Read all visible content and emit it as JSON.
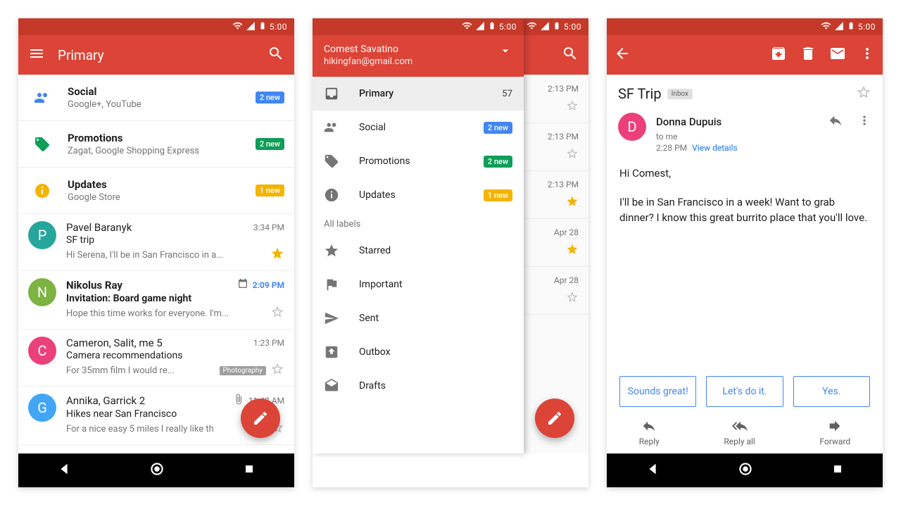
{
  "status": {
    "time": "5:00"
  },
  "screen1": {
    "title": "Primary",
    "categories": [
      {
        "icon": "people-icon",
        "title": "Social",
        "sub": "Google+, YouTube",
        "badge": "2 new",
        "badgeClass": "b-blue"
      },
      {
        "icon": "tag-icon",
        "title": "Promotions",
        "sub": "Zagat, Google Shopping Express",
        "badge": "2 new",
        "badgeClass": "b-green"
      },
      {
        "icon": "info-icon",
        "title": "Updates",
        "sub": "Google Store",
        "badge": "1 new",
        "badgeClass": "b-amber"
      }
    ],
    "messages": [
      {
        "avatar": "P",
        "color": "#26a69a",
        "from": "Pavel Baranyk",
        "subj": "SF trip",
        "prev": "Hi Serena, I'll be in San Francisco in a...",
        "time": "3:34 PM",
        "starred": true,
        "bold": false
      },
      {
        "avatar": "N",
        "color": "#7cb342",
        "from": "Nikolus Ray",
        "subj": "Invitation: Board game night",
        "prev": "Hope this time works for everyone. I'm...",
        "time": "2:09 PM",
        "starred": false,
        "bold": true,
        "cal": true
      },
      {
        "avatar": "C",
        "color": "#ec407a",
        "from": "Cameron, Salit, me 5",
        "subj": "Camera recommendations",
        "prev": "For 35mm film I would re...",
        "chip": "Photography",
        "time": "1:23 PM",
        "starred": false,
        "bold": false
      },
      {
        "avatar": "G",
        "color": "#42a5f5",
        "from": "Annika, Garrick 2",
        "subj": "Hikes near San Francisco",
        "prev": "For a nice easy 5 miles I really like th",
        "time": "11:48 AM",
        "starred": false,
        "bold": false,
        "clip": true
      }
    ]
  },
  "screen2": {
    "account": {
      "name": "Comest Savatino",
      "email": "hikingfan@gmail.com"
    },
    "items": [
      {
        "icon": "inbox-icon",
        "label": "Primary",
        "count": "57",
        "sel": true
      },
      {
        "icon": "people-icon",
        "label": "Social",
        "badge": "2 new",
        "badgeClass": "b-blue"
      },
      {
        "icon": "tag-icon",
        "label": "Promotions",
        "badge": "2 new",
        "badgeClass": "b-green"
      },
      {
        "icon": "info-icon",
        "label": "Updates",
        "badge": "1 new",
        "badgeClass": "b-amber"
      }
    ],
    "section": "All labels",
    "labels": [
      {
        "icon": "star-icon",
        "label": "Starred"
      },
      {
        "icon": "flag-icon",
        "label": "Important"
      },
      {
        "icon": "send-icon",
        "label": "Sent"
      },
      {
        "icon": "outbox-icon",
        "label": "Outbox"
      },
      {
        "icon": "drafts-icon",
        "label": "Drafts"
      }
    ],
    "peek": [
      {
        "time": "2:13 PM",
        "star": false
      },
      {
        "time": "2:13 PM",
        "star": false
      },
      {
        "time": "2:13 PM",
        "star": true
      },
      {
        "time": "Apr 28",
        "star": true
      },
      {
        "time": "Apr 28",
        "star": false
      }
    ]
  },
  "screen3": {
    "subject": "SF Trip",
    "labelChip": "Inbox",
    "sender": {
      "avatar": "D",
      "color": "#ec407a",
      "name": "Donna Dupuis",
      "to": "to me",
      "time": "2:28 PM",
      "details": "View details"
    },
    "body": [
      "Hi Comest,",
      "I'll be in San Francisco in a week! Want to grab dinner? I know this great burrito place that you'll love."
    ],
    "smart": [
      "Sounds great!",
      "Let's do it.",
      "Yes."
    ],
    "actions": [
      "Reply",
      "Reply all",
      "Forward"
    ]
  }
}
